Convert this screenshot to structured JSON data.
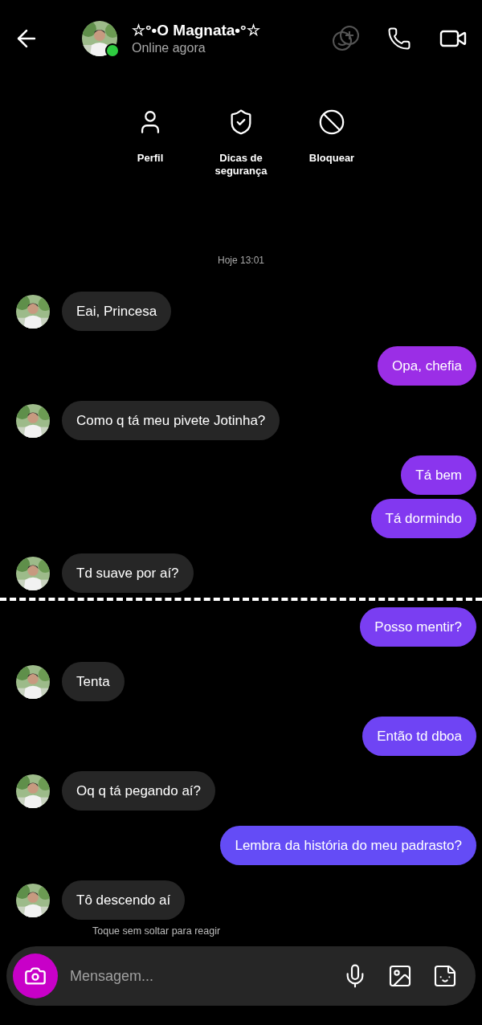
{
  "header": {
    "title": "☆°•O Magnata•°☆",
    "subtitle": "Online agora",
    "online": true
  },
  "actions": [
    {
      "kind": "profile",
      "label": "Perfil"
    },
    {
      "kind": "safety",
      "label": "Dicas de segurança"
    },
    {
      "kind": "block",
      "label": "Bloquear"
    }
  ],
  "timestamp": "Hoje 13:01",
  "messages": [
    {
      "kind": "received",
      "text": "Eai, Princesa"
    },
    {
      "kind": "sent",
      "text": "Opa, chefia",
      "color": "#9b2ee6"
    },
    {
      "kind": "received",
      "text": "Como q tá meu pivete Jotinha?"
    },
    {
      "kind": "sent",
      "text": "Tá bem",
      "color": "#8a35ee"
    },
    {
      "kind": "sent",
      "text": "Tá dormindo",
      "color": "#8238f0"
    },
    {
      "kind": "received",
      "text": "Td suave por aí?"
    },
    {
      "kind": "divider"
    },
    {
      "kind": "sent",
      "text": "Posso mentir?",
      "color": "#7a3ef2"
    },
    {
      "kind": "received",
      "text": "Tenta"
    },
    {
      "kind": "sent",
      "text": "Então td dboa",
      "color": "#6f44f4"
    },
    {
      "kind": "received",
      "text": "Oq q tá pegando aí?"
    },
    {
      "kind": "sent",
      "text": "Lembra da história do meu padrasto?",
      "color": "#644cf6"
    },
    {
      "kind": "received",
      "text": "Tô descendo aí"
    }
  ],
  "hint": "Toque sem soltar para reagir",
  "composer": {
    "placeholder": "Mensagem..."
  }
}
